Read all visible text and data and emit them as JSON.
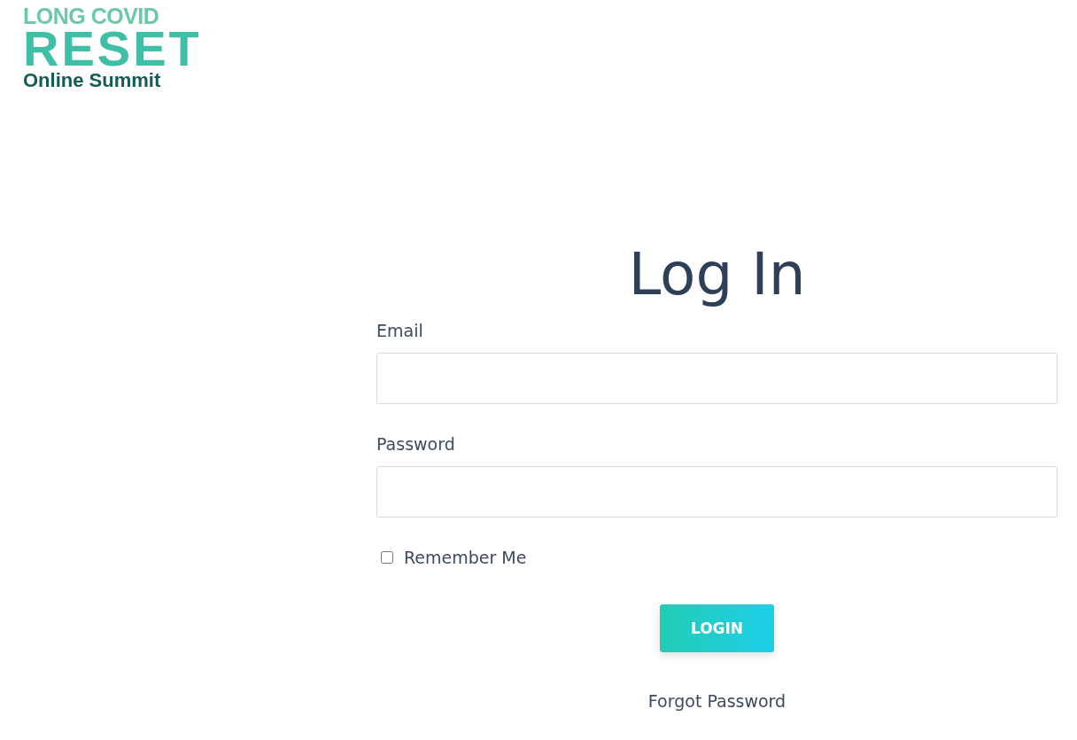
{
  "logo": {
    "line_1": "LONG COVID",
    "line_2": "RESET",
    "line_3": "Online Summit"
  },
  "title": "Log In",
  "fields": [
    {
      "label": "Email"
    },
    {
      "label": "Password"
    }
  ],
  "remember": {
    "label": "Remember Me",
    "checked": false
  },
  "button": "LOGIN",
  "forgot_link": "Forgot Password"
}
